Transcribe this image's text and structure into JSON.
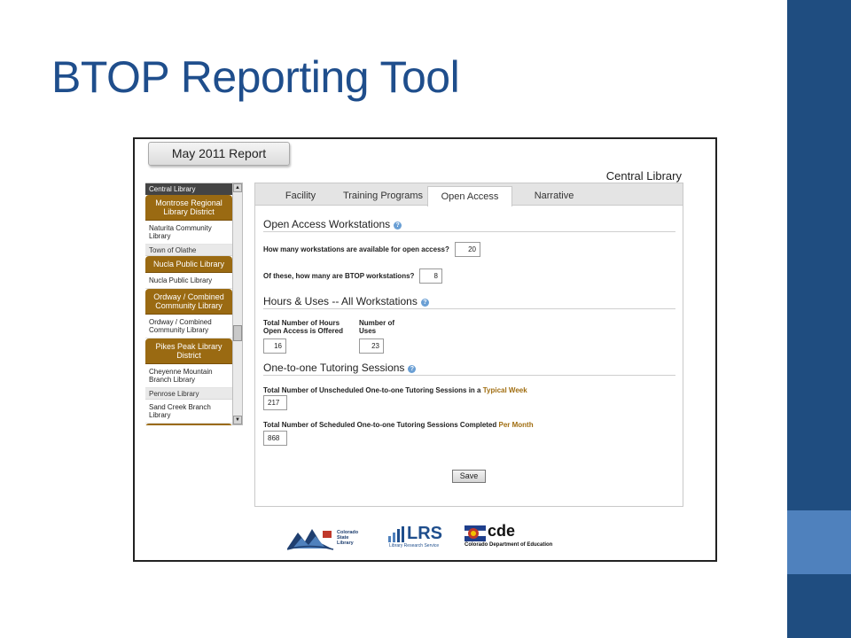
{
  "slide": {
    "title": "BTOP Reporting Tool"
  },
  "report": {
    "tab_label": "May 2011 Report",
    "branch_name": "Central Library"
  },
  "sidebar": {
    "items": [
      {
        "kind": "group",
        "label": "Central Library"
      },
      {
        "kind": "district",
        "label": "Montrose Regional Library District"
      },
      {
        "kind": "library",
        "label": "Naturita Community Library"
      },
      {
        "kind": "gray",
        "label": "Town of Olathe"
      },
      {
        "kind": "district",
        "label": "Nucla Public Library"
      },
      {
        "kind": "library",
        "label": "Nucla Public Library"
      },
      {
        "kind": "district",
        "label": "Ordway / Combined Community Library"
      },
      {
        "kind": "library",
        "label": "Ordway / Combined Community Library"
      },
      {
        "kind": "district",
        "label": "Pikes Peak Library District"
      },
      {
        "kind": "library",
        "label": "Cheyenne Mountain Branch Library"
      },
      {
        "kind": "gray",
        "label": "Penrose Library"
      },
      {
        "kind": "library",
        "label": "Sand Creek Branch Library"
      }
    ]
  },
  "tabs": [
    {
      "label": "Facility"
    },
    {
      "label": "Training Programs"
    },
    {
      "label": "Open Access",
      "active": true
    },
    {
      "label": "Narrative"
    }
  ],
  "form": {
    "sections": {
      "open_access": "Open Access Workstations",
      "hours_uses": "Hours & Uses -- All Workstations",
      "tutoring": "One-to-one Tutoring Sessions"
    },
    "q_workstations": "How many workstations are available for open access?",
    "v_workstations": "20",
    "q_btop": "Of these, how many are BTOP workstations?",
    "v_btop": "8",
    "hours_label_1": "Total Number of Hours",
    "hours_label_2": "Open Access is Offered",
    "v_hours": "16",
    "uses_label_1": "Number of",
    "uses_label_2": "Uses",
    "v_uses": "23",
    "q_unscheduled": "Total Number of Unscheduled One-to-one Tutoring Sessions in a ",
    "q_unscheduled_link": "Typical Week",
    "v_unscheduled": "217",
    "q_scheduled": "Total Number of Scheduled One-to-one Tutoring Sessions Completed ",
    "q_scheduled_link": "Per Month",
    "v_scheduled": "868",
    "save_label": "Save",
    "help_glyph": "?"
  },
  "logos": {
    "csl_text_1": "Colorado",
    "csl_text_2": "State",
    "csl_text_3": "Library",
    "lrs_big": "LRS",
    "lrs_small": "Library Research Service",
    "cde_big": "cde",
    "cde_small": "Colorado Department of Education"
  },
  "colors": {
    "title_blue": "#1f4e8c",
    "band_dark": "#1f4d80",
    "band_light": "#4f81bd",
    "district_gold": "#9a6a12",
    "link_gold": "#a06d10"
  }
}
